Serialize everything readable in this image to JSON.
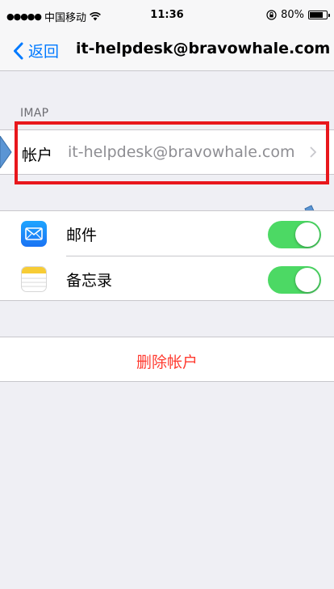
{
  "status_bar": {
    "signal_dots": "●●●●●",
    "carrier": "中国移动",
    "wifi_icon": "wifi-icon",
    "time": "11:36",
    "lock_icon": "orientation-lock-icon",
    "battery_percent": "80%",
    "battery_level": 0.8
  },
  "nav": {
    "back_label": "返回",
    "title": "it-helpdesk@bravowhale.com"
  },
  "section": {
    "header": "IMAP"
  },
  "account_row": {
    "label": "帐户",
    "value": "it-helpdesk@bravowhale.com"
  },
  "toggles": [
    {
      "icon": "mail-icon",
      "label": "邮件",
      "on": true
    },
    {
      "icon": "notes-icon",
      "label": "备忘录",
      "on": true
    }
  ],
  "delete": {
    "label": "删除帐户"
  },
  "colors": {
    "accent": "#007aff",
    "toggle_on": "#4cd964",
    "destructive": "#ff3b30",
    "highlight": "#e8171c",
    "annotation_arrow": "#5b95d4"
  }
}
